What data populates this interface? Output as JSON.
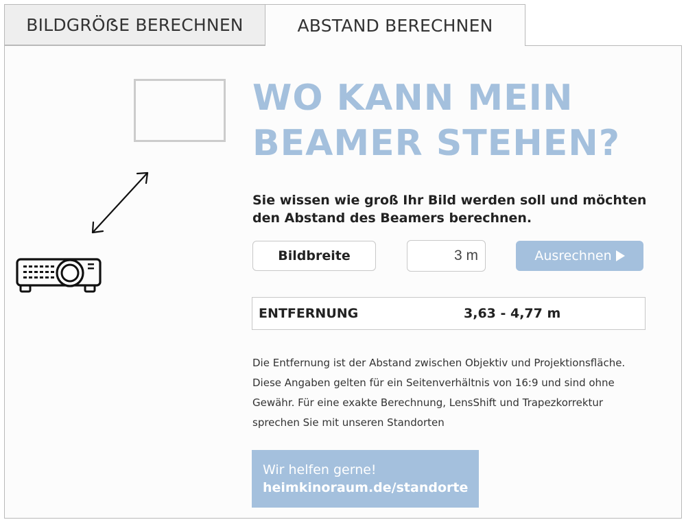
{
  "tabs": [
    {
      "label": "BILDGRÖẞE BERECHNEN",
      "active": false
    },
    {
      "label": "ABSTAND BERECHNEN",
      "active": true
    }
  ],
  "headline": {
    "line1": "WO KANN MEIN",
    "line2": "BEAMER STEHEN?"
  },
  "subtitle": {
    "line1": "Sie wissen wie groß Ihr Bild werden soll und möchten",
    "line2": "den Abstand des Beamers berechnen."
  },
  "controls": {
    "mode_label": "Bildbreite",
    "value": "3 m",
    "calculate_label": "Ausrechnen"
  },
  "result": {
    "label": "ENTFERNUNG",
    "value": "3,63 - 4,77 m"
  },
  "note": {
    "lines": [
      "Die Entfernung ist der Abstand zwischen Objektiv und Projektionsfläche.",
      "Diese Angaben gelten für ein Seitenverhältnis von 16:9 und sind ohne",
      "Gewähr. Für eine exakte Berechnung, LensShift und Trapezkorrektur",
      "sprechen Sie mit unseren Standorten"
    ]
  },
  "help": {
    "line1": "Wir helfen gerne!",
    "line2": "heimkinoraum.de/standorte"
  },
  "colors": {
    "accent": "#a4c0dd",
    "tab_inactive_bg": "#eeeeee",
    "border": "#b9b9b9",
    "text": "#222222"
  },
  "icons": {
    "screen": "screen-rect-icon",
    "arrow": "double-arrow-icon",
    "projector": "projector-icon",
    "play": "play-icon"
  }
}
